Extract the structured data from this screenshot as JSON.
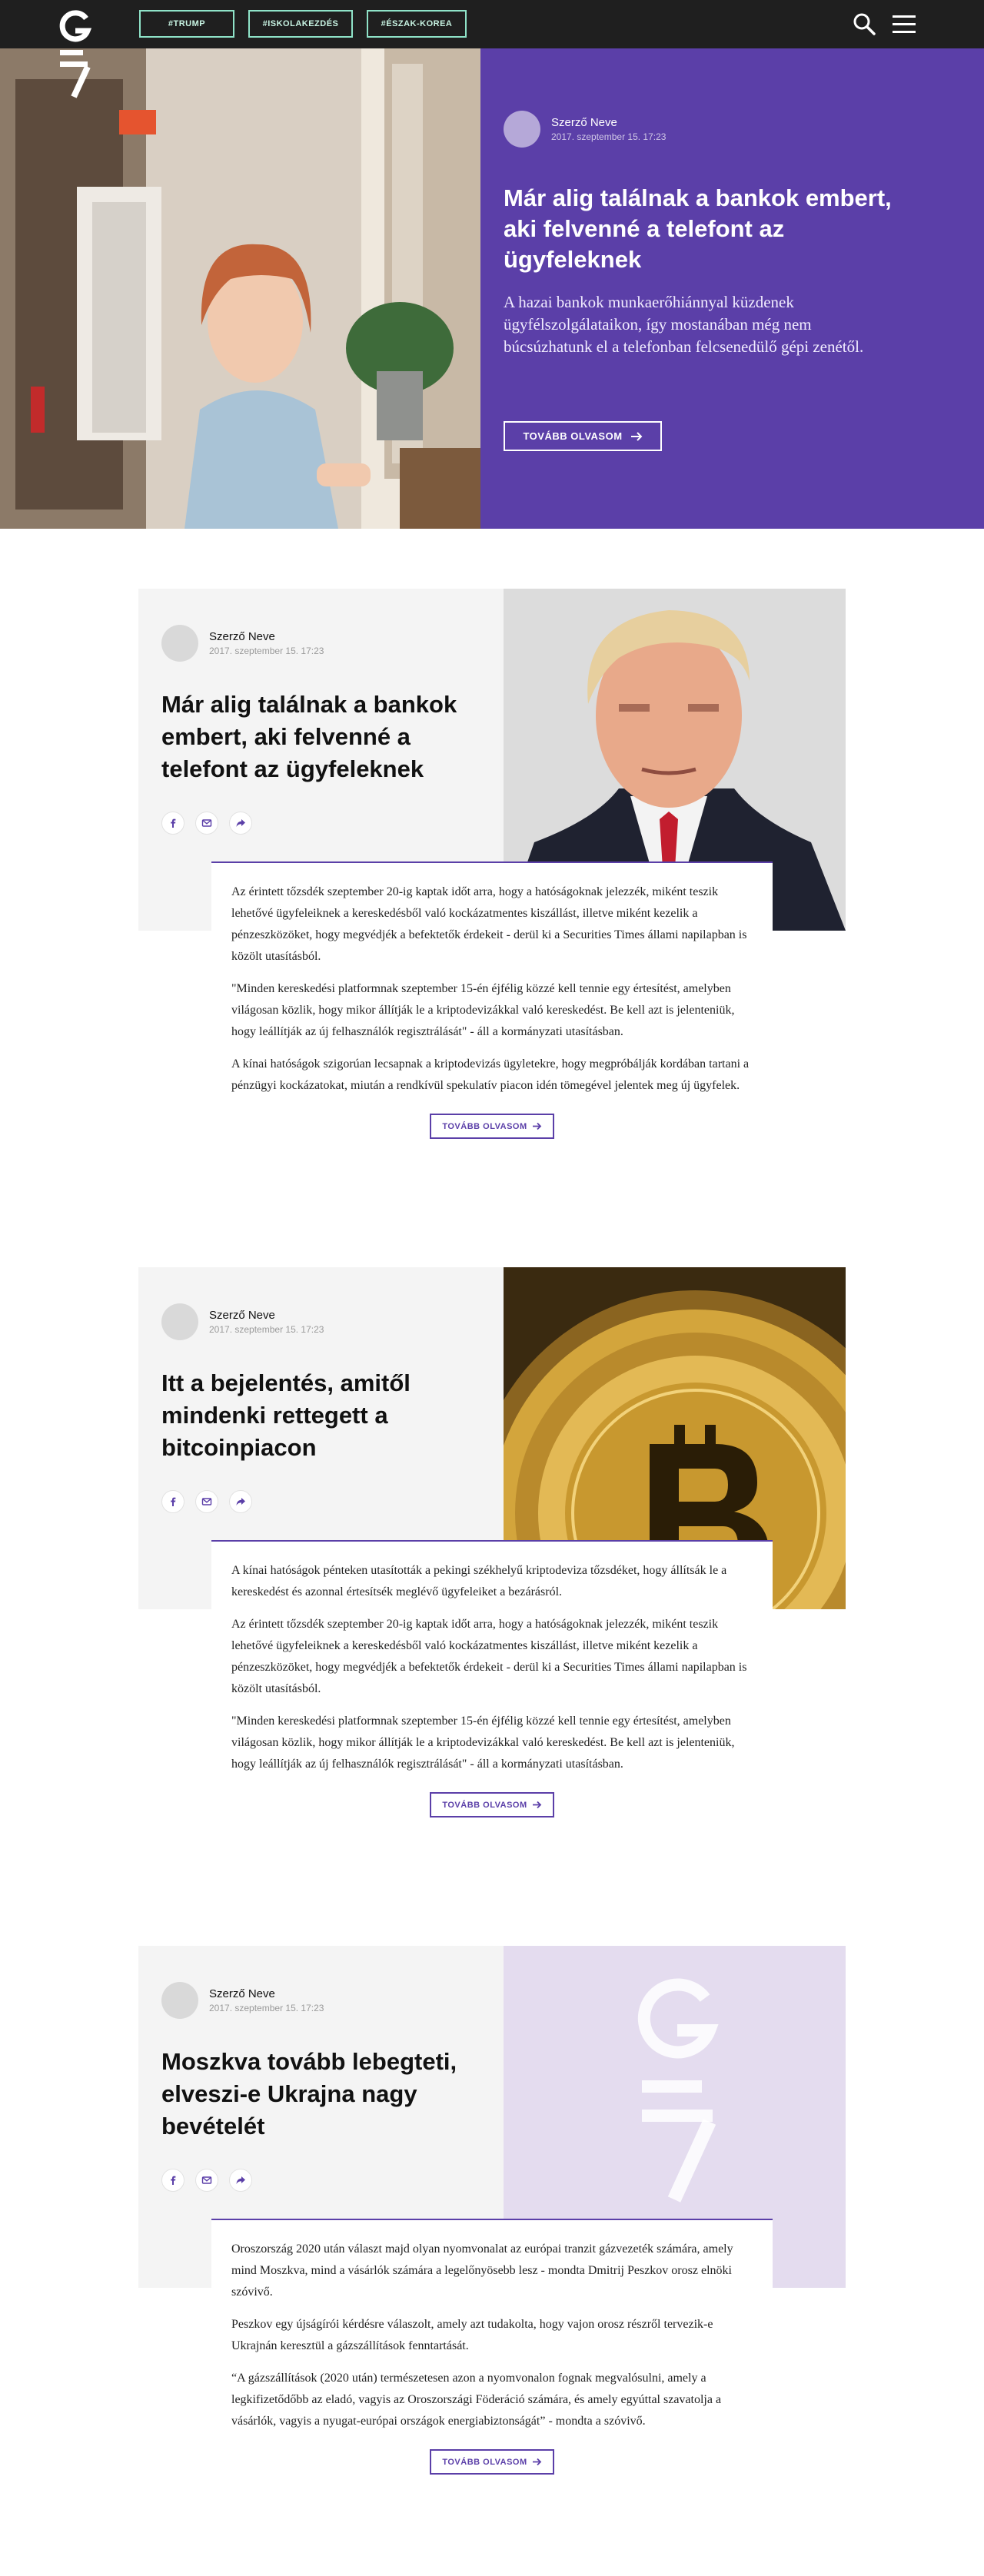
{
  "nav": {
    "tags": [
      "#TRUMP",
      "#ISKOLAKEZDÉS",
      "#ÉSZAK-KOREA"
    ]
  },
  "hero": {
    "author_name": "Szerző Neve",
    "author_date": "2017. szeptember 15. 17:23",
    "title": "Már alig találnak a bankok embert, aki felvenné a telefont az ügyfeleknek",
    "lead": "A hazai bankok munkaerőhiánnyal küzdenek ügyfélszolgálataikon, így mostanában még nem búcsúzhatunk el a telefonban felcsenedülő gépi zenétől.",
    "more_label": "TOVÁBB OLVASOM"
  },
  "articles": [
    {
      "author_name": "Szerző Neve",
      "author_date": "2017. szeptember 15. 17:23",
      "title": "Már alig találnak a bankok embert, aki felvenné a telefont az ügyfeleknek",
      "paragraphs": [
        "Az érintett tőzsdék szeptember 20-ig kaptak időt arra, hogy a hatóságoknak jelezzék, miként teszik lehetővé ügyfeleiknek a kereskedésből való kockázatmentes kiszállást, illetve miként kezelik a pénzeszközöket, hogy megvédjék a befektetők érdekeit - derül ki a Securities Times állami napilapban is közölt utasításból.",
        "\"Minden kereskedési platformnak szeptember 15-én éjfélig közzé kell tennie egy értesítést, amelyben világosan közlik, hogy mikor állítják le a kriptodevizákkal való kereskedést. Be kell azt is jelenteniük, hogy leállítják az új felhasználók regisztrálását\" - áll a kormányzati utasításban.",
        "A kínai hatóságok szigorúan lecsapnak a kriptodevizás ügyletekre, hogy megpróbálják kordában tartani a pénzügyi kockázatokat, miután a rendkívül spekulatív piacon idén tömegével jelentek meg új ügyfelek."
      ],
      "more_label": "TOVÁBB OLVASOM"
    },
    {
      "author_name": "Szerző Neve",
      "author_date": "2017. szeptember 15. 17:23",
      "title": "Itt a bejelentés, amitől mindenki rettegett a bitcoinpiacon",
      "paragraphs": [
        "A kínai hatóságok pénteken utasították a pekingi székhelyű kriptodeviza tőzsdéket, hogy állítsák le a kereskedést és azonnal értesítsék meglévő ügyfeleiket a bezárásról.",
        "Az érintett tőzsdék szeptember 20-ig kaptak időt arra, hogy a hatóságoknak jelezzék, miként teszik lehetővé ügyfeleiknek a kereskedésből való kockázatmentes kiszállást, illetve miként kezelik a pénzeszközöket, hogy megvédjék a befektetők érdekeit - derül ki a Securities Times állami napilapban is közölt utasításból.",
        "\"Minden kereskedési platformnak szeptember 15-én éjfélig közzé kell tennie egy értesítést, amelyben világosan közlik, hogy mikor állítják le a kriptodevizákkal való kereskedést. Be kell azt is jelenteniük, hogy leállítják az új felhasználók regisztrálását\" - áll a kormányzati utasításban."
      ],
      "more_label": "TOVÁBB OLVASOM"
    },
    {
      "author_name": "Szerző Neve",
      "author_date": "2017. szeptember 15. 17:23",
      "title": "Moszkva tovább lebegteti, elveszi-e Ukrajna nagy bevételét",
      "paragraphs": [
        "Oroszország 2020 után választ majd olyan nyomvonalat az európai tranzit gázvezeték számára, amely mind Moszkva, mind a vásárlók számára a legelőnyösebb lesz - mondta Dmitrij Peszkov orosz elnöki szóvivő.",
        "Peszkov egy újságírói kérdésre válaszolt, amely azt tudakolta, hogy vajon orosz részről tervezik-e Ukrajnán keresztül a gázszállítások fenntartását.",
        "“A gázszállítások (2020 után) természetesen azon a nyomvonalon fognak megvalósulni, amely a legkifizetődőbb az eladó, vagyis az Oroszországi Föderáció számára, és amely egyúttal szavatolja a vásárlók, vagyis a nyugat-európai országok energiabiztonságát” - mondta a szóvivő."
      ],
      "more_label": "TOVÁBB OLVASOM"
    }
  ],
  "colors": {
    "brand_purple": "#5b3fa8",
    "nav_bg": "#1f1f1f",
    "tag_border": "#8fe3c8"
  },
  "icons": [
    "g7-logo",
    "search-icon",
    "hamburger-menu-icon",
    "facebook-icon",
    "email-icon",
    "share-icon",
    "arrow-right-icon"
  ]
}
